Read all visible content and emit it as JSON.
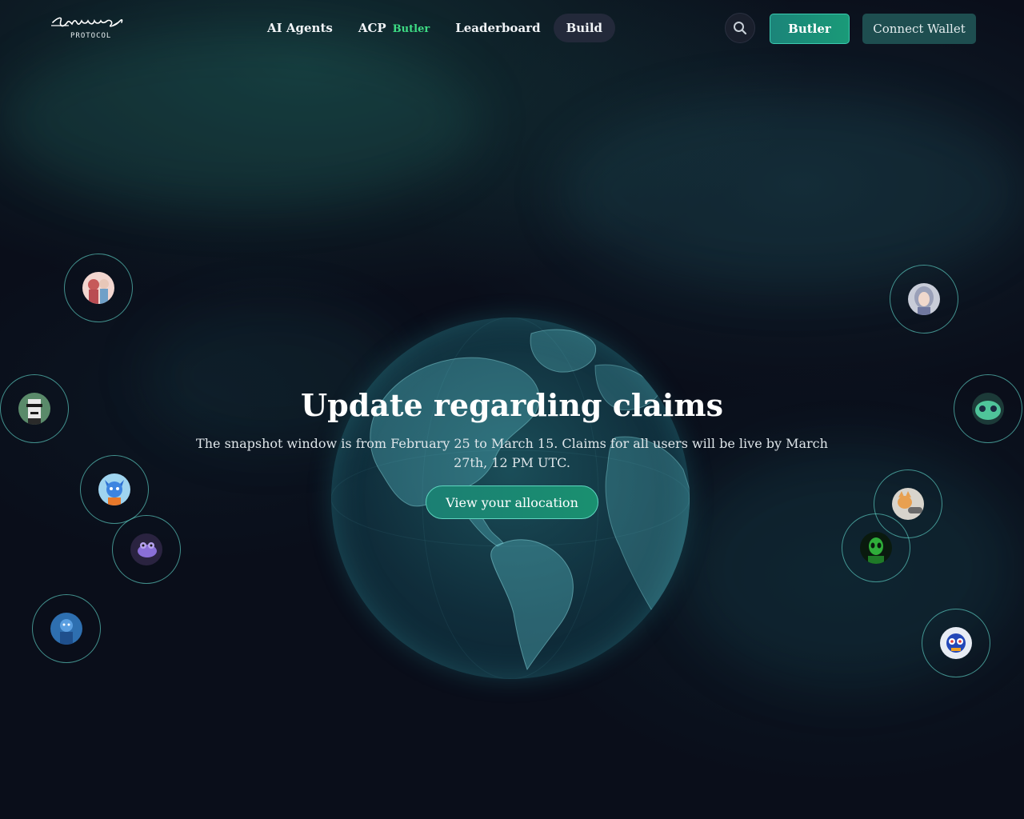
{
  "brand": {
    "logo_script": "Virtual",
    "logo_sub": "PROTOCOL"
  },
  "nav": {
    "items": [
      {
        "label": "AI Agents",
        "active": false
      },
      {
        "label": "ACP",
        "badge": "Butler",
        "active": false
      },
      {
        "label": "Leaderboard",
        "active": false
      },
      {
        "label": "Build",
        "active": true
      }
    ]
  },
  "header_actions": {
    "search_icon": "search-icon",
    "butler_label": "Butler",
    "wallet_label": "Connect Wallet"
  },
  "hero": {
    "title": "Update regarding claims",
    "subtitle": "The snapshot window is from February 25 to March 15. Claims for all users will be live by March 27th, 12 PM UTC.",
    "cta_label": "View your allocation"
  },
  "colors": {
    "background": "#0a0e1a",
    "accent": "#1a9a78",
    "badge": "#3ddc84",
    "ring": "#5ac8be"
  },
  "agents": [
    {
      "name": "agent-avatar-anime-couple"
    },
    {
      "name": "agent-avatar-pixel-ape"
    },
    {
      "name": "agent-avatar-blue-fox"
    },
    {
      "name": "agent-avatar-purple-frog"
    },
    {
      "name": "agent-avatar-blue-character"
    },
    {
      "name": "agent-avatar-silver-hair-girl"
    },
    {
      "name": "agent-avatar-green-blob"
    },
    {
      "name": "agent-avatar-cat-hand"
    },
    {
      "name": "agent-avatar-green-alien"
    },
    {
      "name": "agent-avatar-colorful-mask"
    }
  ]
}
